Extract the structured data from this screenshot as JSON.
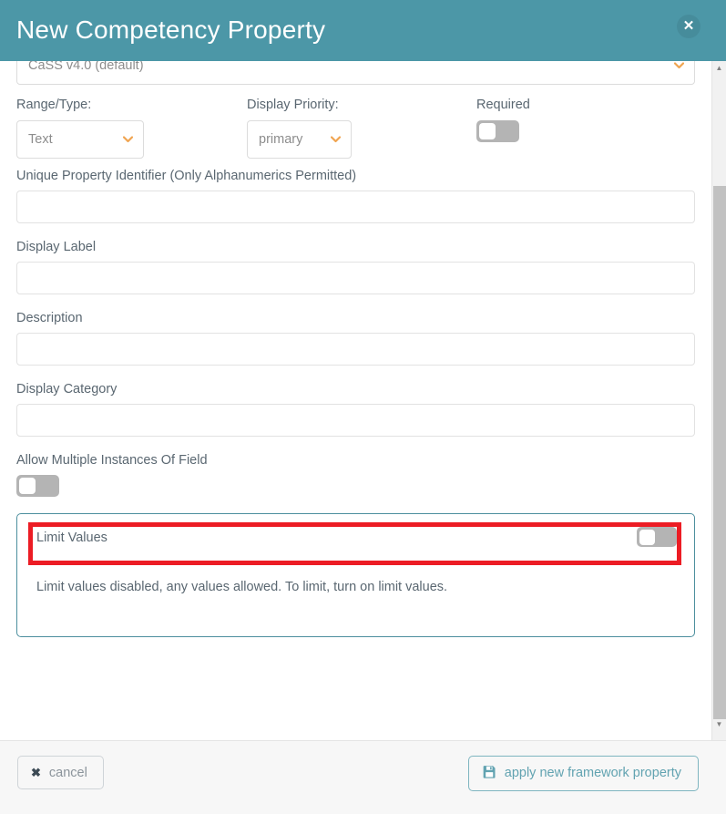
{
  "header": {
    "title": "New Competency Property",
    "close_label": "✕",
    "close_icon": "close-icon",
    "bg_color": "#4c97a7"
  },
  "form": {
    "framework_select": {
      "value": "CaSS v4.0 (default)",
      "chevron_icon": "chevron-down-icon"
    },
    "range_type": {
      "label": "Range/Type:",
      "value": "Text",
      "chevron_icon": "chevron-down-icon"
    },
    "display_priority": {
      "label": "Display Priority:",
      "value": "primary",
      "chevron_icon": "chevron-down-icon"
    },
    "required": {
      "label": "Required",
      "state": "off"
    },
    "unique_identifier": {
      "label": "Unique Property Identifier (Only Alphanumerics Permitted)",
      "value": "",
      "placeholder": ""
    },
    "display_label": {
      "label": "Display Label",
      "value": "",
      "placeholder": ""
    },
    "description": {
      "label": "Description",
      "value": "",
      "placeholder": ""
    },
    "display_category": {
      "label": "Display Category",
      "value": "",
      "placeholder": ""
    },
    "allow_multiple": {
      "label": "Allow Multiple Instances Of Field",
      "state": "off"
    },
    "limit_values": {
      "title": "Limit Values",
      "state": "off",
      "description": "Limit values disabled, any values allowed. To limit, turn on limit values.",
      "highlight_color": "#ec1c24",
      "panel_border_color": "#4c8f9e"
    }
  },
  "footer": {
    "cancel_label": "cancel",
    "cancel_icon": "close-icon",
    "apply_label": "apply new framework property",
    "apply_icon": "save-icon",
    "apply_color": "#62a3b1"
  },
  "scrollbar": {
    "up_arrow": "▲",
    "down_arrow": "▼"
  }
}
